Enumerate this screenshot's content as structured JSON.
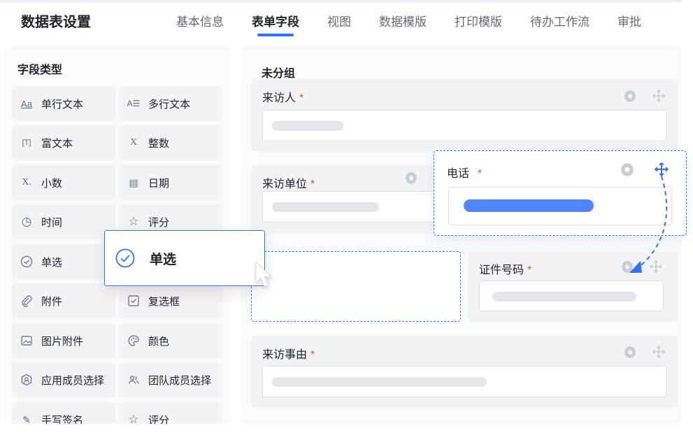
{
  "header": {
    "title": "数据表设置",
    "tabs": [
      {
        "label": "基本信息",
        "active": false
      },
      {
        "label": "表单字段",
        "active": true
      },
      {
        "label": "视图",
        "active": false
      },
      {
        "label": "数据模版",
        "active": false
      },
      {
        "label": "打印模版",
        "active": false
      },
      {
        "label": "待办工作流",
        "active": false
      },
      {
        "label": "审批",
        "active": false
      }
    ]
  },
  "field_types": {
    "title": "字段类型",
    "items": [
      {
        "label": "单行文本",
        "icon": "single-line-text-icon",
        "glyph": "Aa"
      },
      {
        "label": "多行文本",
        "icon": "multi-line-text-icon",
        "glyph": "A☰"
      },
      {
        "label": "富文本",
        "icon": "rich-text-icon",
        "glyph": "[T]"
      },
      {
        "label": "整数",
        "icon": "integer-icon",
        "glyph": "X"
      },
      {
        "label": "小数",
        "icon": "decimal-icon",
        "glyph": "X."
      },
      {
        "label": "日期",
        "icon": "date-icon",
        "glyph": "▤"
      },
      {
        "label": "时间",
        "icon": "clock-icon",
        "glyph": "◷"
      },
      {
        "label": "评分",
        "icon": "star-icon",
        "glyph": "☆"
      },
      {
        "label": "单选",
        "icon": "radio-check-icon",
        "glyph": "✓"
      },
      {
        "label": "",
        "icon": "",
        "glyph": ""
      },
      {
        "label": "附件",
        "icon": "paperclip-icon",
        "glyph": "⌇"
      },
      {
        "label": "复选框",
        "icon": "checkbox-icon",
        "glyph": "☑"
      },
      {
        "label": "图片附件",
        "icon": "image-icon",
        "glyph": "▨"
      },
      {
        "label": "颜色",
        "icon": "palette-icon",
        "glyph": "◍"
      },
      {
        "label": "应用成员选择",
        "icon": "member-icon",
        "glyph": "◉"
      },
      {
        "label": "团队成员选择",
        "icon": "team-icon",
        "glyph": "⚇"
      },
      {
        "label": "手写签名",
        "icon": "signature-icon",
        "glyph": "✎"
      },
      {
        "label": "评分",
        "icon": "star-icon",
        "glyph": "☆"
      }
    ]
  },
  "form": {
    "group_title": "未分组",
    "fields": {
      "visitor": {
        "label": "来访人",
        "required_mark": "*"
      },
      "visitor_unit": {
        "label": "来访单位",
        "required_mark": "*"
      },
      "phone": {
        "label": "电话",
        "required_mark": "*"
      },
      "id_number": {
        "label": "证件号码",
        "required_mark": "*"
      },
      "reason": {
        "label": "来访事由",
        "required_mark": "*"
      }
    }
  },
  "drag_preview": {
    "label": "单选"
  },
  "colors": {
    "accent": "#3370ff",
    "required": "#f54a45",
    "panel": "#f2f3f5"
  }
}
